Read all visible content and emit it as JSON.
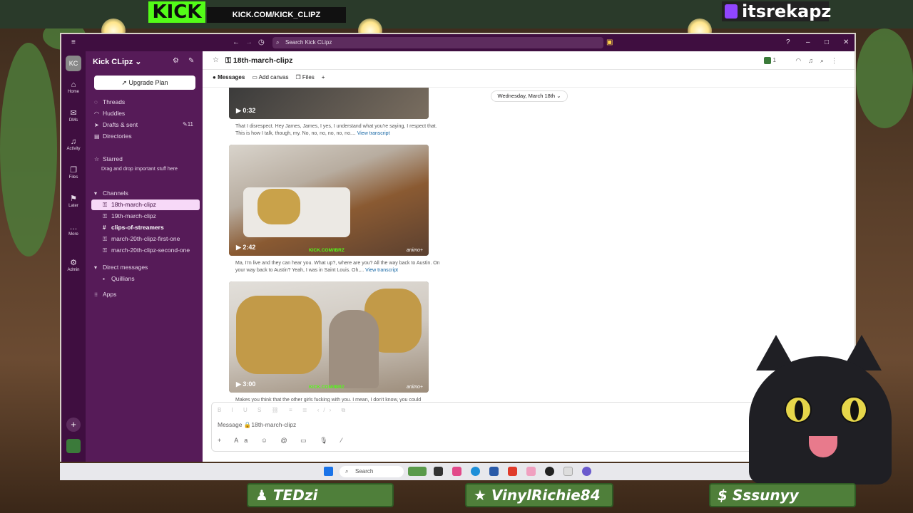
{
  "overlay": {
    "kick_logo": "KICK",
    "kick_url": "KICK.COM/KICK_CLIPZ",
    "twitch_handle": "itsrekapz",
    "viewers": [
      "TEDzi",
      "VinylRichie84",
      "Sssunyy"
    ],
    "viewer_icons": [
      "user-icon",
      "star-icon",
      "dollar-icon"
    ]
  },
  "titlebar": {
    "search_placeholder": "Search Kick CLipz"
  },
  "rail": {
    "avatar": "KC",
    "items": [
      {
        "label": "Home",
        "icon": "home-icon"
      },
      {
        "label": "DMs",
        "icon": "dm-icon"
      },
      {
        "label": "Activity",
        "icon": "bell-icon"
      },
      {
        "label": "Files",
        "icon": "files-icon"
      },
      {
        "label": "Later",
        "icon": "bookmark-icon"
      },
      {
        "label": "More",
        "icon": "more-icon"
      },
      {
        "label": "Admin",
        "icon": "gear-icon"
      }
    ]
  },
  "sidebar": {
    "workspace": "Kick CLipz",
    "upgrade_label": "Upgrade Plan",
    "nav": [
      {
        "label": "Threads"
      },
      {
        "label": "Huddles"
      },
      {
        "label": "Drafts & sent",
        "badge": "11"
      },
      {
        "label": "Directories"
      }
    ],
    "starred_header": "Starred",
    "starred_hint": "Drag and drop important stuff here",
    "channels_header": "Channels",
    "channels": [
      {
        "label": "18th-march-clipz",
        "selected": true
      },
      {
        "label": "19th-march-clipz"
      },
      {
        "label": "clips-of-streamers",
        "bold": true
      },
      {
        "label": "march-20th-clipz-first-one"
      },
      {
        "label": "march-20th-clipz-second-one"
      }
    ],
    "dm_header": "Direct messages",
    "dms": [
      {
        "label": "Quillians"
      }
    ],
    "apps_label": "Apps"
  },
  "channel": {
    "title": "18th-march-clipz",
    "member_count": "1",
    "tabs": [
      "Messages",
      "Add canvas",
      "Files"
    ],
    "date_pill": "Wednesday, March 18th",
    "videos": [
      {
        "duration": "0:32",
        "transcript": "That I disrespect. Hey James, James, I yes, I understand what you're saying, I respect that. This is how I talk, though, my. No, no, no, no, no, no....",
        "link": "View transcript"
      },
      {
        "duration": "2:42",
        "transcript": "Ma, I'm live and they can hear you. What up?, where are you? All the way back to Austin. On your way back to Austin? Yeah, I was in Saint Louis. Oh,...",
        "link": "View transcript",
        "watermark": "animo+",
        "kick_tag": "KICK.COM/IBRZ"
      },
      {
        "duration": "3:00",
        "transcript": "Makes you think that the other girls fucking with you. I mean, I don't know, you could",
        "link": "",
        "watermark": "animo+",
        "kick_tag": "KICK.COM/IBRZ"
      }
    ],
    "composer_placeholder": "Message 🔒18th-march-clipz",
    "format_icons": "B I U S ⛓ ≡ ≣ ‹/› ⧉",
    "composer_tools": "+ Aa ☺ @ ▭ 🎙 ⁄"
  },
  "taskbar": {
    "search_label": "Search"
  },
  "colors": {
    "aubergine": "#3f0e40",
    "sidebar": "#561b58",
    "selected": "#f7d9f8",
    "kick_green": "#53fc18",
    "link": "#1264a3"
  }
}
